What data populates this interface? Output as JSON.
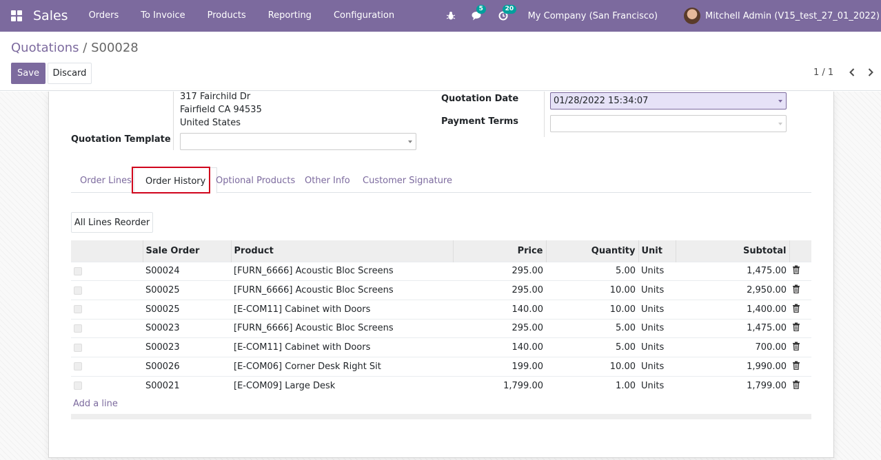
{
  "navbar": {
    "app_name": "Sales",
    "menu": [
      "Orders",
      "To Invoice",
      "Products",
      "Reporting",
      "Configuration"
    ],
    "messages_badge": "5",
    "activities_badge": "20",
    "company": "My Company (San Francisco)",
    "user": "Mitchell Admin (V15_test_27_01_2022)",
    "accent_color": "#7C6A9E"
  },
  "breadcrumb": {
    "parent": "Quotations",
    "separator": " / ",
    "current": "S00028"
  },
  "buttons": {
    "save": "Save",
    "discard": "Discard",
    "reorder": "All Lines Reorder",
    "add_line": "Add a line"
  },
  "pager": {
    "text": "1 / 1"
  },
  "form": {
    "address": [
      "317 Fairchild Dr",
      "Fairfield CA 94535",
      "United States"
    ],
    "quotation_template_label": "Quotation Template",
    "quotation_template_value": "",
    "quotation_date_label": "Quotation Date",
    "quotation_date_value": "01/28/2022 15:34:07",
    "payment_terms_label": "Payment Terms",
    "payment_terms_value": ""
  },
  "tabs": [
    "Order Lines",
    "Order History",
    "Optional Products",
    "Other Info",
    "Customer Signature"
  ],
  "active_tab": "Order History",
  "table": {
    "headers": [
      "Sale Order",
      "Product",
      "Price",
      "Quantity",
      "Unit",
      "Subtotal"
    ],
    "rows": [
      {
        "order": "S00024",
        "product": "[FURN_6666] Acoustic Bloc Screens",
        "price": "295.00",
        "qty": "5.00",
        "unit": "Units",
        "subtotal": "1,475.00"
      },
      {
        "order": "S00025",
        "product": "[FURN_6666] Acoustic Bloc Screens",
        "price": "295.00",
        "qty": "10.00",
        "unit": "Units",
        "subtotal": "2,950.00"
      },
      {
        "order": "S00025",
        "product": "[E-COM11] Cabinet with Doors",
        "price": "140.00",
        "qty": "10.00",
        "unit": "Units",
        "subtotal": "1,400.00"
      },
      {
        "order": "S00023",
        "product": "[FURN_6666] Acoustic Bloc Screens",
        "price": "295.00",
        "qty": "5.00",
        "unit": "Units",
        "subtotal": "1,475.00"
      },
      {
        "order": "S00023",
        "product": "[E-COM11] Cabinet with Doors",
        "price": "140.00",
        "qty": "5.00",
        "unit": "Units",
        "subtotal": "700.00"
      },
      {
        "order": "S00026",
        "product": "[E-COM06] Corner Desk Right Sit",
        "price": "199.00",
        "qty": "10.00",
        "unit": "Units",
        "subtotal": "1,990.00"
      },
      {
        "order": "S00021",
        "product": "[E-COM09] Large Desk",
        "price": "1,799.00",
        "qty": "1.00",
        "unit": "Units",
        "subtotal": "1,799.00"
      }
    ]
  }
}
